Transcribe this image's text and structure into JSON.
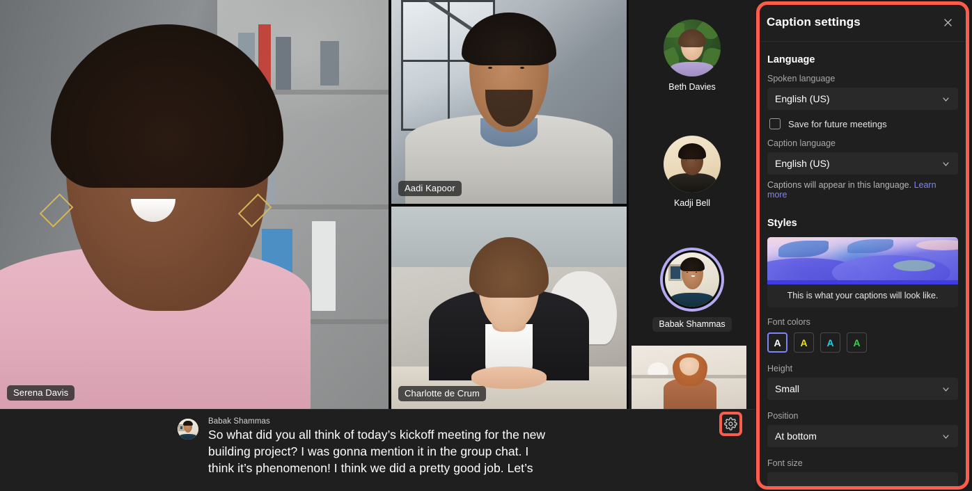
{
  "meeting": {
    "main_tile": {
      "name": "Serena Davis"
    },
    "tiles": [
      {
        "name": "Aadi Kapoor"
      },
      {
        "name": "Charlotte de Crum"
      }
    ],
    "filmstrip": [
      {
        "name": "Beth Davies",
        "active": false
      },
      {
        "name": "Kadji Bell",
        "active": false
      },
      {
        "name": "Babak Shammas",
        "active": true
      }
    ]
  },
  "caption": {
    "speaker": "Babak Shammas",
    "lines": [
      "So what did you all think of today’s kickoff meeting for the new",
      "building project? I was gonna mention it in the group chat. I",
      "think it’s phenomenon! I think we did a pretty good job. Let’s"
    ]
  },
  "toolbar": {
    "settings_icon": "gear-icon"
  },
  "panel": {
    "title": "Caption settings",
    "close_icon": "close-icon",
    "language": {
      "section_title": "Language",
      "spoken_label": "Spoken language",
      "spoken_value": "English (US)",
      "save_checkbox_label": "Save for future meetings",
      "save_checkbox_checked": false,
      "caption_label": "Caption language",
      "caption_value": "English (US)",
      "hint_text": "Captions will appear in this language.",
      "hint_link": "Learn more"
    },
    "styles": {
      "section_title": "Styles",
      "preview_text": "This is what your captions will look like.",
      "font_colors_label": "Font colors",
      "font_colors": [
        {
          "glyph": "A",
          "color": "#ffffff",
          "selected": true
        },
        {
          "glyph": "A",
          "color": "#f2e00d",
          "selected": false
        },
        {
          "glyph": "A",
          "color": "#17d4e8",
          "selected": false
        },
        {
          "glyph": "A",
          "color": "#2fd44f",
          "selected": false
        }
      ],
      "height_label": "Height",
      "height_value": "Small",
      "position_label": "Position",
      "position_value": "At bottom",
      "font_size_label": "Font size"
    }
  },
  "colors": {
    "highlight": "#fb5c4c",
    "accent_link": "#7f85f5",
    "active_speaker_ring": "#b3aaf2",
    "panel_bg": "#1f1f1f",
    "field_bg": "#292929"
  }
}
